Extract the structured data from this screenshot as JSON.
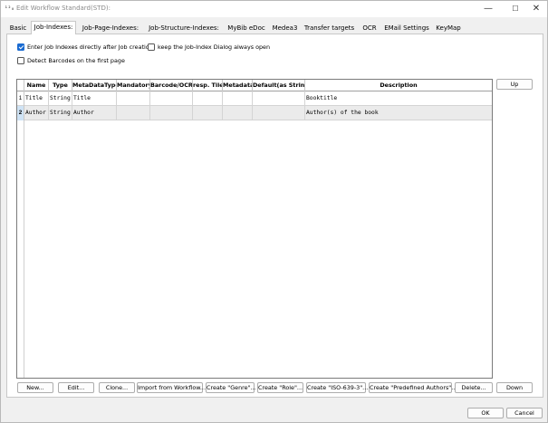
{
  "window": {
    "icon_text": "¹²₀",
    "title": "Edit Workflow Standard(STD):",
    "minimize_glyph": "—",
    "maximize_glyph": "☐",
    "close_glyph": "✕"
  },
  "tabs": [
    {
      "label": "Basic",
      "active": false
    },
    {
      "label": "Job-Indexes:",
      "active": true
    },
    {
      "label": "Job-Page-Indexes:",
      "active": false
    },
    {
      "label": "Job-Structure-Indexes:",
      "active": false
    },
    {
      "label": "MyBib eDoc",
      "active": false
    },
    {
      "label": "Medea3",
      "active": false
    },
    {
      "label": "Transfer targets",
      "active": false
    },
    {
      "label": "OCR",
      "active": false
    },
    {
      "label": "EMail Settings",
      "active": false
    },
    {
      "label": "KeyMap",
      "active": false
    }
  ],
  "options": {
    "enter_job_indexes": {
      "label": "Enter Job Indexes directly after Job creation",
      "checked": true
    },
    "keep_dialog_open": {
      "label": "keep the Job-Index Dialog always open",
      "checked": false
    },
    "detect_barcodes": {
      "label": "Detect Barcodes on the first page",
      "checked": false
    }
  },
  "grid": {
    "columns": [
      "Name",
      "Type",
      "MetaDataType",
      "Mandatory",
      "Barcode/OCR",
      "resp. Tile",
      "Metadata",
      "Default(as String)",
      "Description"
    ],
    "rows": [
      {
        "num": "1",
        "cells": [
          "Title",
          "String",
          "Title",
          "",
          "",
          "",
          "",
          "",
          "Booktitle"
        ],
        "selected": false
      },
      {
        "num": "2",
        "cells": [
          "Author",
          "String",
          "Author",
          "",
          "",
          "",
          "",
          "",
          "Author(s) of the book"
        ],
        "selected": true
      }
    ]
  },
  "buttons": {
    "up": "Up",
    "down": "Down",
    "new": "New...",
    "edit": "Edit...",
    "clone": "Clone...",
    "import": "Import from Workflow...",
    "create_genre": "Create \"Genre\"...",
    "create_role": "Create \"Role\"...",
    "create_iso": "Create \"ISO-639-3\"...",
    "create_predefined_authors": "Create \"Predefined Authors\"...",
    "delete": "Delete...",
    "ok": "OK",
    "cancel": "Cancel"
  },
  "colors": {
    "accent": "#1a6bd1",
    "selected_row": "#ebebeb",
    "selected_rownum": "#cfe3f5"
  }
}
